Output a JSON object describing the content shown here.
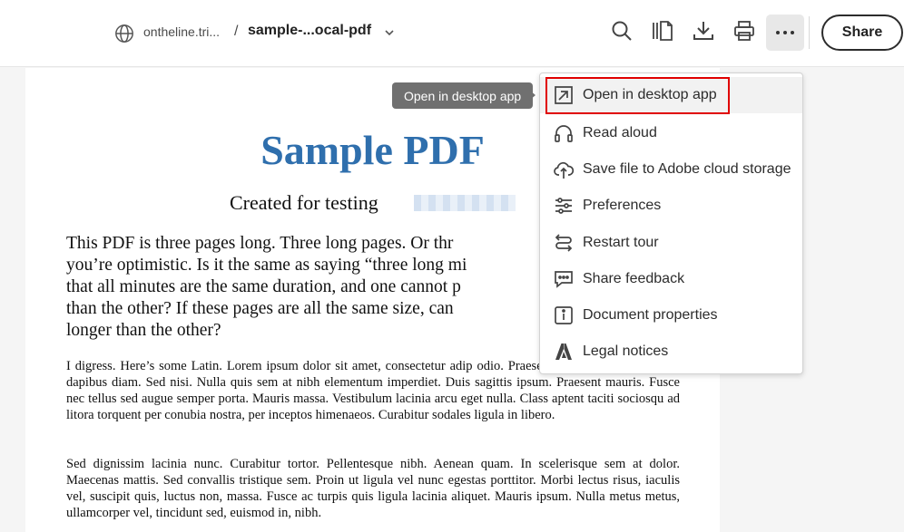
{
  "header": {
    "site": "ontheline.tri...",
    "separator": "/",
    "filename": "sample-...ocal-pdf",
    "share_label": "Share"
  },
  "document": {
    "title": "Sample PDF",
    "subtitle": "Created for testing",
    "para1_lines": [
      "This PDF is three pages long. Three long pages. Or thr",
      "you’re optimistic. Is it the same as saying “three long mi",
      "that all minutes are the same duration, and one cannot p",
      "than the other? If these pages are all the same size, can",
      "longer than the other?"
    ],
    "para2": "I digress. Here’s some Latin. Lorem ipsum dolor sit amet, consectetur adip odio. Praesent libero. Sed cursus ante dapibus diam. Sed nisi. Nulla quis sem at nibh elementum imperdiet. Duis sagittis ipsum. Praesent mauris. Fusce nec tellus sed augue semper porta. Mauris massa. Vestibulum lacinia arcu eget nulla. Class aptent taciti sociosqu ad litora torquent per conubia nostra, per inceptos himenaeos. Curabitur sodales ligula in libero.",
    "para3": "Sed dignissim lacinia nunc. Curabitur tortor. Pellentesque nibh. Aenean quam. In scelerisque sem at dolor. Maecenas mattis. Sed convallis tristique sem. Proin ut ligula vel nunc egestas porttitor. Morbi lectus risus, iaculis vel, suscipit quis, luctus non, massa. Fusce ac turpis quis ligula lacinia aliquet. Mauris ipsum. Nulla metus metus, ullamcorper vel, tincidunt sed, euismod in, nibh."
  },
  "tooltip": "Open in desktop app",
  "menu": {
    "items": [
      {
        "label": "Open in desktop app",
        "icon": "open-external-icon"
      },
      {
        "label": "Read aloud",
        "icon": "headphones-icon"
      },
      {
        "label": "Save file to Adobe cloud storage",
        "icon": "cloud-upload-icon"
      },
      {
        "label": "Preferences",
        "icon": "sliders-icon"
      },
      {
        "label": "Restart tour",
        "icon": "restart-icon"
      },
      {
        "label": "Share feedback",
        "icon": "feedback-icon"
      },
      {
        "label": "Document properties",
        "icon": "info-icon"
      },
      {
        "label": "Legal notices",
        "icon": "adobe-logo-icon"
      }
    ]
  },
  "colors": {
    "title_blue": "#2f6fad",
    "focus_red": "#e00000"
  }
}
